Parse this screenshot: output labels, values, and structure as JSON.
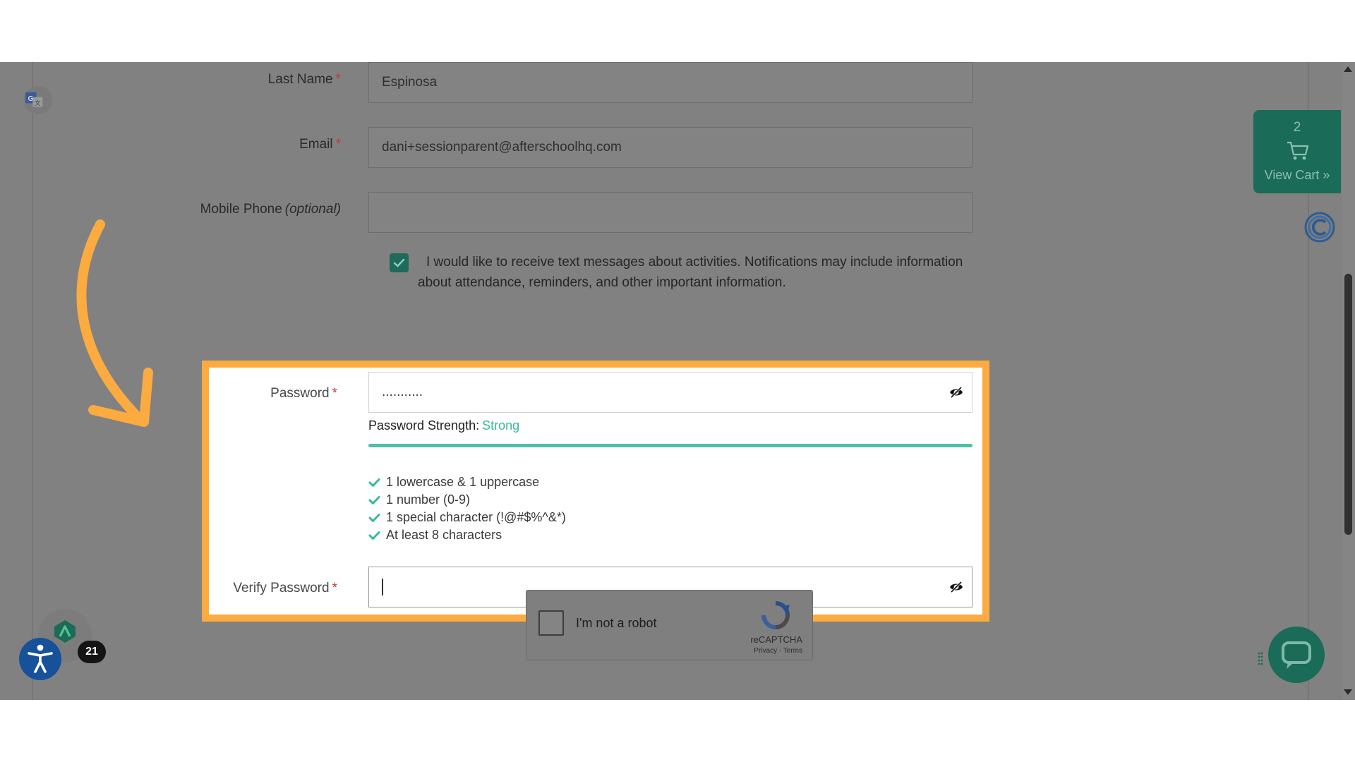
{
  "form": {
    "last_name": {
      "label": "Last Name",
      "required_mark": "*",
      "value": "Espinosa"
    },
    "email": {
      "label": "Email",
      "required_mark": "*",
      "value": "dani+sessionparent@afterschoolhq.com"
    },
    "mobile_phone": {
      "label": "Mobile Phone",
      "optional_note": "(optional)",
      "value": ""
    },
    "sms_opt_in": {
      "checked": true,
      "text": "I would like to receive text messages about activities. Notifications may include information about attendance, reminders, and other important information."
    },
    "password": {
      "label": "Password",
      "required_mark": "*",
      "masked_value": "...........",
      "strength_label": "Password Strength:",
      "strength_value": "Strong",
      "strength_percent": 100,
      "rules": [
        "1 lowercase & 1 uppercase",
        "1 number (0-9)",
        "1 special character (!@#$%^&*)",
        "At least 8 characters"
      ]
    },
    "verify_password": {
      "label": "Verify Password",
      "required_mark": "*",
      "value": ""
    }
  },
  "captcha": {
    "label": "I'm not a robot",
    "brand": "reCAPTCHA",
    "links": "Privacy - Terms"
  },
  "cart": {
    "count": "2",
    "label": "View Cart »"
  },
  "notification_count": "21",
  "colors": {
    "highlight": "#fbab3f",
    "accent_green": "#1a6b58",
    "strength_strong": "#3bb89a",
    "overlay_grey": "#818181",
    "accessibility_blue": "#17519a"
  },
  "icons": {
    "translate": "google-translate-icon",
    "eye": "eye-slash-icon",
    "check": "check-icon",
    "cart": "shopping-cart-icon",
    "chat": "chat-icon",
    "accessibility": "accessibility-icon",
    "annotation": "curved-arrow-annotation"
  }
}
